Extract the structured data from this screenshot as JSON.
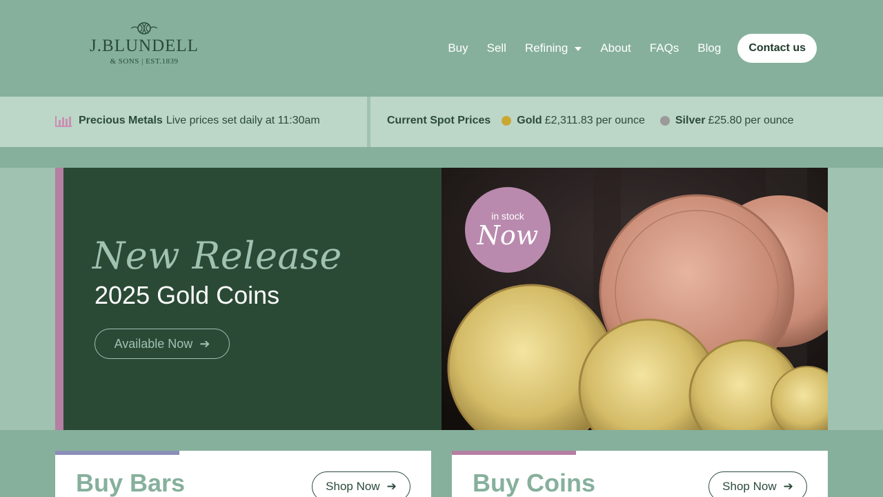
{
  "brand": {
    "name": "J.BLUNDELL",
    "sub": "& SONS | EST.1839"
  },
  "nav": {
    "items": [
      "Buy",
      "Sell",
      "Refining",
      "About",
      "FAQs",
      "Blog"
    ],
    "contact_label": "Contact us"
  },
  "prices": {
    "heading": "Precious Metals",
    "note": "Live prices set daily at 11:30am",
    "spot_label": "Current Spot Prices",
    "gold": {
      "name": "Gold",
      "price": "£2,311.83",
      "unit": "per ounce",
      "color": "#c9a832"
    },
    "silver": {
      "name": "Silver",
      "price": "£25.80",
      "unit": "per ounce",
      "color": "#9a9a9a"
    }
  },
  "hero": {
    "title": "New Release",
    "subtitle": "2025 Gold Coins",
    "button_label": "Available Now",
    "badge_top": "in stock",
    "badge_main": "Now"
  },
  "cards": [
    {
      "title": "Buy Bars",
      "button_label": "Shop Now",
      "accent": "#8a8fb8"
    },
    {
      "title": "Buy Coins",
      "button_label": "Shop Now",
      "accent": "#b47fa2"
    }
  ],
  "colors": {
    "header_bg": "#86b09c",
    "hero_bg": "#2b4a36",
    "accent_pink": "#b47fa2"
  }
}
